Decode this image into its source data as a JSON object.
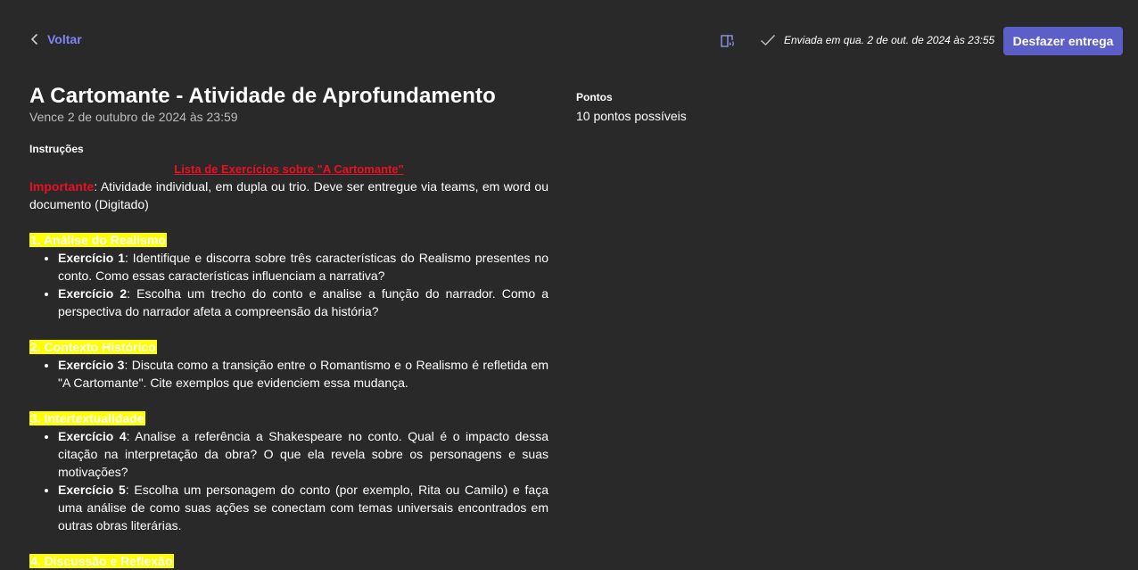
{
  "header": {
    "back_label": "Voltar",
    "status_text": "Enviada em qua. 2 de out. de 2024 às 23:55",
    "undo_button": "Desfazer entrega",
    "accent": "#7f85f5",
    "button_color": "#5b5fc7"
  },
  "assignment": {
    "title": "A Cartomante - Atividade de Aprofundamento",
    "due": "Vence 2 de outubro de 2024 às 23:59",
    "instructions_label": "Instruções",
    "list_title": "Lista de Exercícios sobre \"A Cartomante\"",
    "important_label": "Importante",
    "important_text": ": Atividade individual, em dupla ou trio. Deve ser entregue via teams, em word ou documento (Digitado)",
    "sections": [
      {
        "heading": "1. Análise do Realismo",
        "items": [
          {
            "label": "Exercício 1",
            "text": ": Identifique e discorra sobre três características do Realismo presentes no conto. Como essas características influenciam a narrativa?"
          },
          {
            "label": "Exercício 2",
            "text": ": Escolha um trecho do conto e analise a função do narrador. Como a perspectiva do narrador afeta a compreensão da história?"
          }
        ]
      },
      {
        "heading": "2. Contexto Histórico",
        "items": [
          {
            "label": "Exercício 3",
            "text": ": Discuta como a transição entre o Romantismo e o Realismo é refletida em \"A Cartomante\". Cite exemplos que evidenciem essa mudança."
          }
        ]
      },
      {
        "heading": "3. Intertextualidade",
        "items": [
          {
            "label": "Exercício 4",
            "text": ": Analise a referência a Shakespeare no conto. Qual é o impacto dessa citação na interpretação da obra? O que ela revela sobre os personagens e suas motivações?"
          },
          {
            "label": "Exercício 5",
            "text": ": Escolha um personagem do conto (por exemplo, Rita ou Camilo) e faça uma análise de como suas ações se conectam com temas universais encontrados em outras obras literárias."
          }
        ]
      },
      {
        "heading": "4. Discussão e Reflexão",
        "items": []
      }
    ]
  },
  "points": {
    "label": "Pontos",
    "value": "10 pontos possíveis"
  },
  "icons": {
    "back": "chevron-left-icon",
    "reader": "immersive-reader-icon",
    "status": "checkmark-icon"
  }
}
